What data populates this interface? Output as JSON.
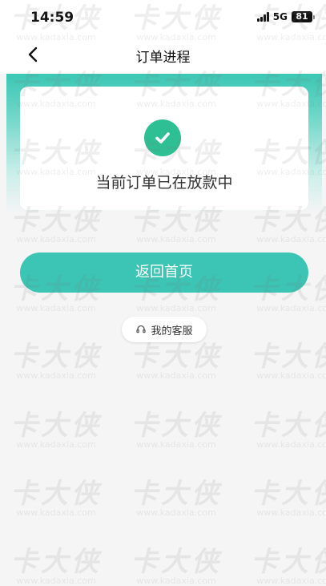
{
  "status_bar": {
    "time": "14:59",
    "network": "5G",
    "battery": "81"
  },
  "nav": {
    "title": "订单进程",
    "back_icon": "chevron-left-icon"
  },
  "card": {
    "icon": "check-circle-icon",
    "message": "当前订单已在放款中"
  },
  "actions": {
    "home_label": "返回首页",
    "service_label": "我的客服",
    "service_icon": "headset-icon"
  },
  "watermark": {
    "logo": "卡大侠",
    "url": "www.kadaxia.com"
  },
  "colors": {
    "accent": "#3cc4b4",
    "check": "#2fbf94",
    "background": "#f5f5f5"
  }
}
